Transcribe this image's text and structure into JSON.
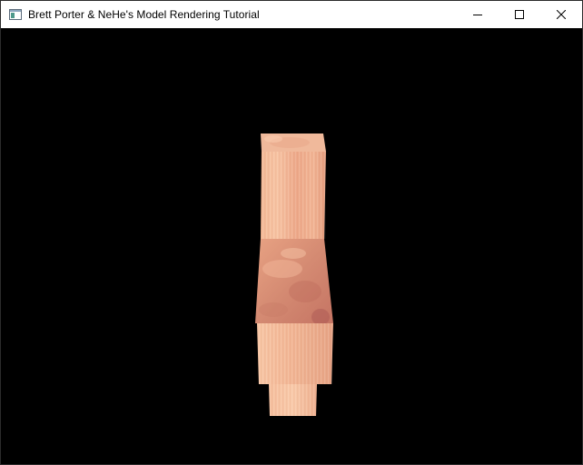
{
  "window": {
    "title": "Brett Porter & NeHe's Model Rendering Tutorial"
  },
  "icons": {
    "app": "application-window-icon",
    "minimize": "minimize-icon",
    "maximize": "maximize-icon",
    "close": "close-icon"
  },
  "colors": {
    "titlebar_bg": "#ffffff",
    "viewport_bg": "#000000",
    "model_skin_light": "#f6c09a",
    "model_skin_mid": "#e9a27e",
    "model_skin_dark": "#c47560"
  }
}
